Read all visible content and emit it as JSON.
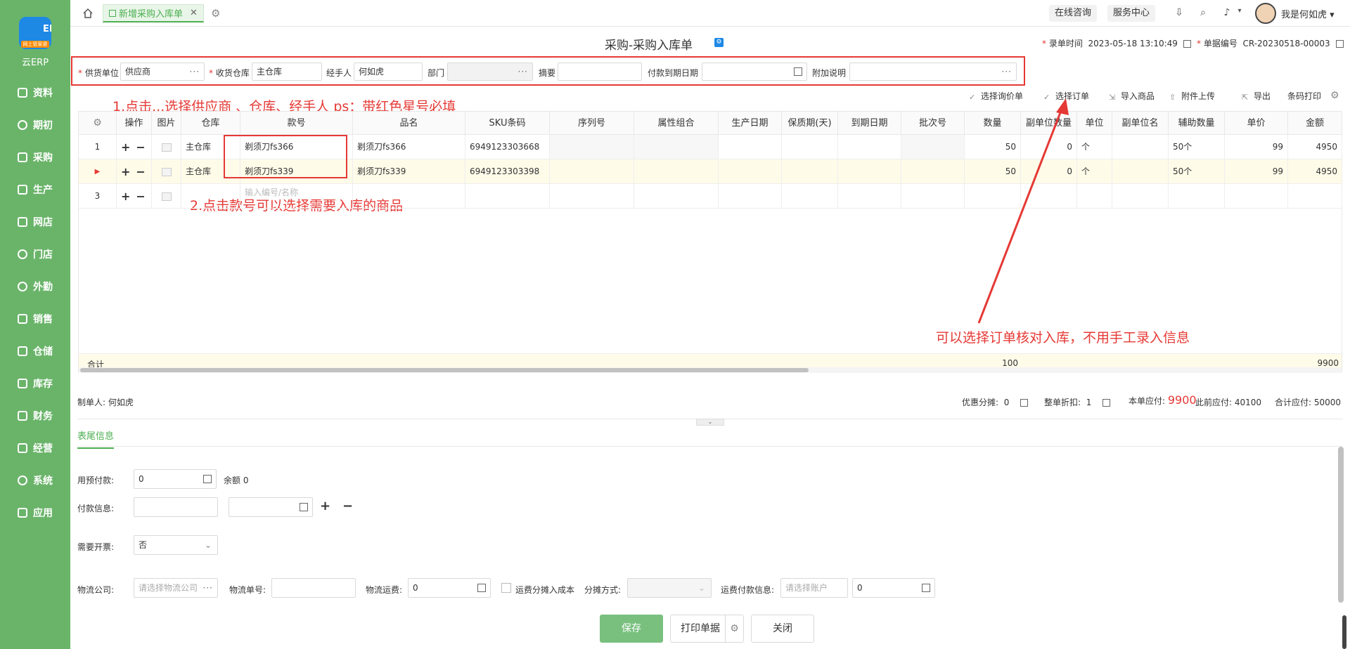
{
  "sidebar": {
    "logo_text": "ERP",
    "logo_badge": "网上管家婆",
    "logo_caption": "云ERP",
    "items": [
      {
        "label": "资料"
      },
      {
        "label": "期初"
      },
      {
        "label": "采购"
      },
      {
        "label": "生产"
      },
      {
        "label": "网店"
      },
      {
        "label": "门店"
      },
      {
        "label": "外勤"
      },
      {
        "label": "销售"
      },
      {
        "label": "仓储"
      },
      {
        "label": "库存"
      },
      {
        "label": "财务"
      },
      {
        "label": "经营"
      },
      {
        "label": "系统"
      },
      {
        "label": "应用"
      }
    ]
  },
  "topbar": {
    "active_tab": "新增采购入库单",
    "consult": "在线咨询",
    "service": "服务中心",
    "user": "我是何如虎"
  },
  "title": {
    "text": "采购-采购入库单",
    "entry_time_label": "录单时间",
    "entry_time": "2023-05-18 13:10:49",
    "doc_no_label": "单据编号",
    "doc_no": "CR-20230518-00003"
  },
  "header_form": {
    "supplier_label": "供货单位",
    "supplier_value": "供应商",
    "warehouse_label": "收货仓库",
    "warehouse_value": "主仓库",
    "handler_label": "经手人",
    "handler_value": "何如虎",
    "dept_label": "部门",
    "summary_label": "摘要",
    "due_label": "付款到期日期",
    "extra_label": "附加说明"
  },
  "annotations": {
    "a1": "1.点击...选择供应商 、仓库、经手人 ps：带红色星号必填",
    "a2": "2.点击款号可以选择需要入库的商品",
    "a3": "可以选择订单核对入库，不用手工录入信息"
  },
  "toolbar": {
    "select_inquiry": "选择询价单",
    "select_order": "选择订单",
    "import_goods": "导入商品",
    "attach_upload": "附件上传",
    "export": "导出",
    "barcode_print": "条码打印"
  },
  "grid": {
    "headers": [
      "操作",
      "图片",
      "仓库",
      "款号",
      "品名",
      "SKU条码",
      "序列号",
      "属性组合",
      "生产日期",
      "保质期(天)",
      "到期日期",
      "批次号",
      "数量",
      "副单位数量",
      "单位",
      "副单位名",
      "辅助数量",
      "单价",
      "金额"
    ],
    "rows": [
      {
        "idx": "1",
        "warehouse": "主仓库",
        "code": "剃须刀fs366",
        "name": "剃须刀fs366",
        "sku": "6949123303668",
        "qty": "50",
        "sub_qty": "0",
        "unit": "个",
        "aux_qty": "50个",
        "price": "99",
        "amount": "4950"
      },
      {
        "idx": "▶",
        "warehouse": "主仓库",
        "code": "剃须刀fs339",
        "name": "剃须刀fs339",
        "sku": "6949123303398",
        "qty": "50",
        "sub_qty": "0",
        "unit": "个",
        "aux_qty": "50个",
        "price": "99",
        "amount": "4950"
      },
      {
        "idx": "3",
        "code_placeholder": "输入编号/名称"
      }
    ],
    "total_label": "合计",
    "total_qty": "100",
    "total_amount": "9900"
  },
  "summary": {
    "maker": "制单人: 何如虎",
    "discount_label": "优惠分摊:",
    "discount": "0",
    "whole_discount_label": "整单折扣:",
    "whole_discount": "1",
    "payable_label": "本单应付:",
    "payable": "9900",
    "prev_payable": "此前应付: 40100",
    "total_payable": "合计应付: 50000"
  },
  "footer_section": {
    "tab": "表尾信息",
    "prepay_label": "用预付款:",
    "prepay_value": "0",
    "balance": "余额 0",
    "pay_info_label": "付款信息:",
    "invoice_label": "需要开票:",
    "invoice_value": "否",
    "logistics_label": "物流公司:",
    "logistics_placeholder": "请选择物流公司",
    "tracking_label": "物流单号:",
    "freight_label": "物流运费:",
    "freight_value": "0",
    "freight_share_label": "运费分摊入成本",
    "share_method_label": "分摊方式:",
    "freight_pay_label": "运费付款信息:",
    "account_placeholder": "请选择账户",
    "freight_pay_value": "0"
  },
  "buttons": {
    "save": "保存",
    "print": "打印单据",
    "close": "关闭"
  }
}
